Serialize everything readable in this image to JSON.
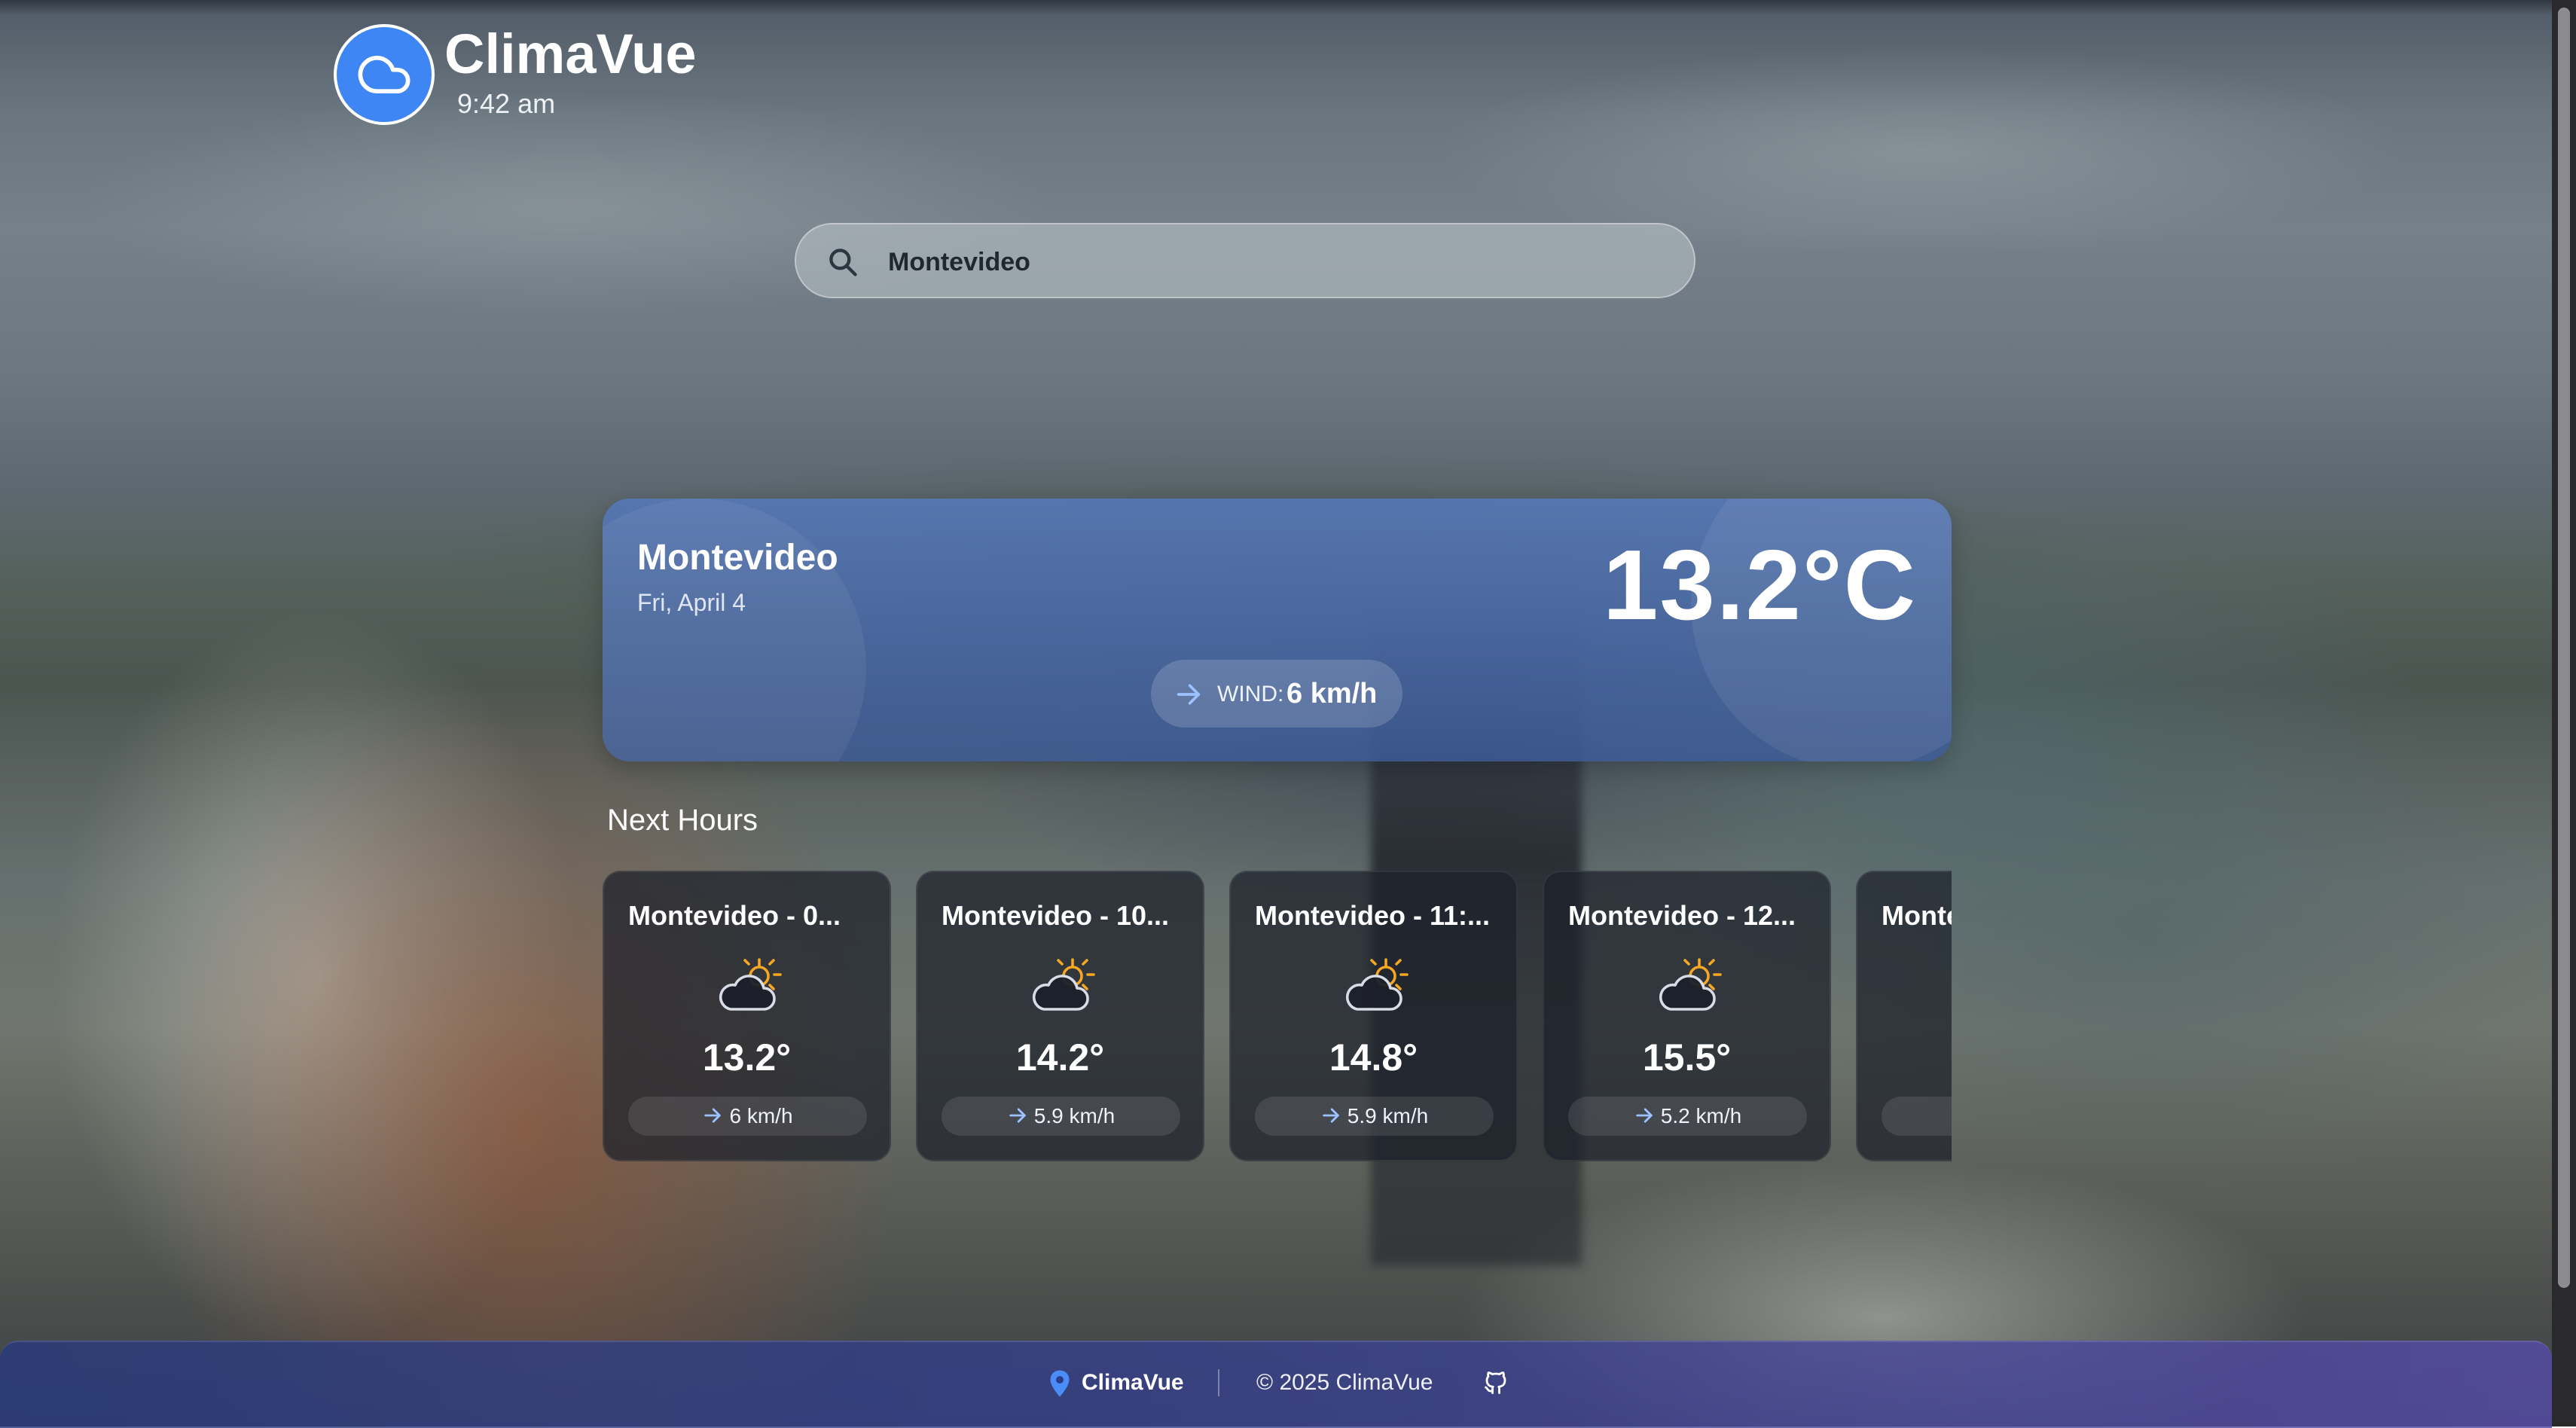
{
  "header": {
    "app_name": "ClimaVue",
    "time": "9:42 am",
    "logo_icon": "cloud-icon",
    "accent_color": "#3f86f5"
  },
  "search": {
    "value": "Montevideo",
    "icon": "search-icon"
  },
  "current": {
    "city": "Montevideo",
    "date": "Fri, April 4",
    "temperature": "13.2°C",
    "wind_label": "WIND:",
    "wind_value": "6 km/h",
    "wind_icon": "arrow-right-icon"
  },
  "next_hours": {
    "title": "Next Hours",
    "items": [
      {
        "title": "Montevideo - 0...",
        "icon": "partly-cloudy-icon",
        "temp": "13.2°",
        "wind": "6 km/h"
      },
      {
        "title": "Montevideo - 10...",
        "icon": "partly-cloudy-icon",
        "temp": "14.2°",
        "wind": "5.9 km/h"
      },
      {
        "title": "Montevideo - 11:...",
        "icon": "partly-cloudy-icon",
        "temp": "14.8°",
        "wind": "5.9 km/h"
      },
      {
        "title": "Montevideo - 12...",
        "icon": "partly-cloudy-icon",
        "temp": "15.5°",
        "wind": "5.2 km/h"
      },
      {
        "title": "Montevideo",
        "icon": "partly-cloudy-icon",
        "temp": "",
        "wind": ""
      }
    ]
  },
  "footer": {
    "brand": "ClimaVue",
    "copyright": "© 2025 ClimaVue",
    "pin_icon": "map-pin-icon",
    "github_icon": "github-icon"
  }
}
